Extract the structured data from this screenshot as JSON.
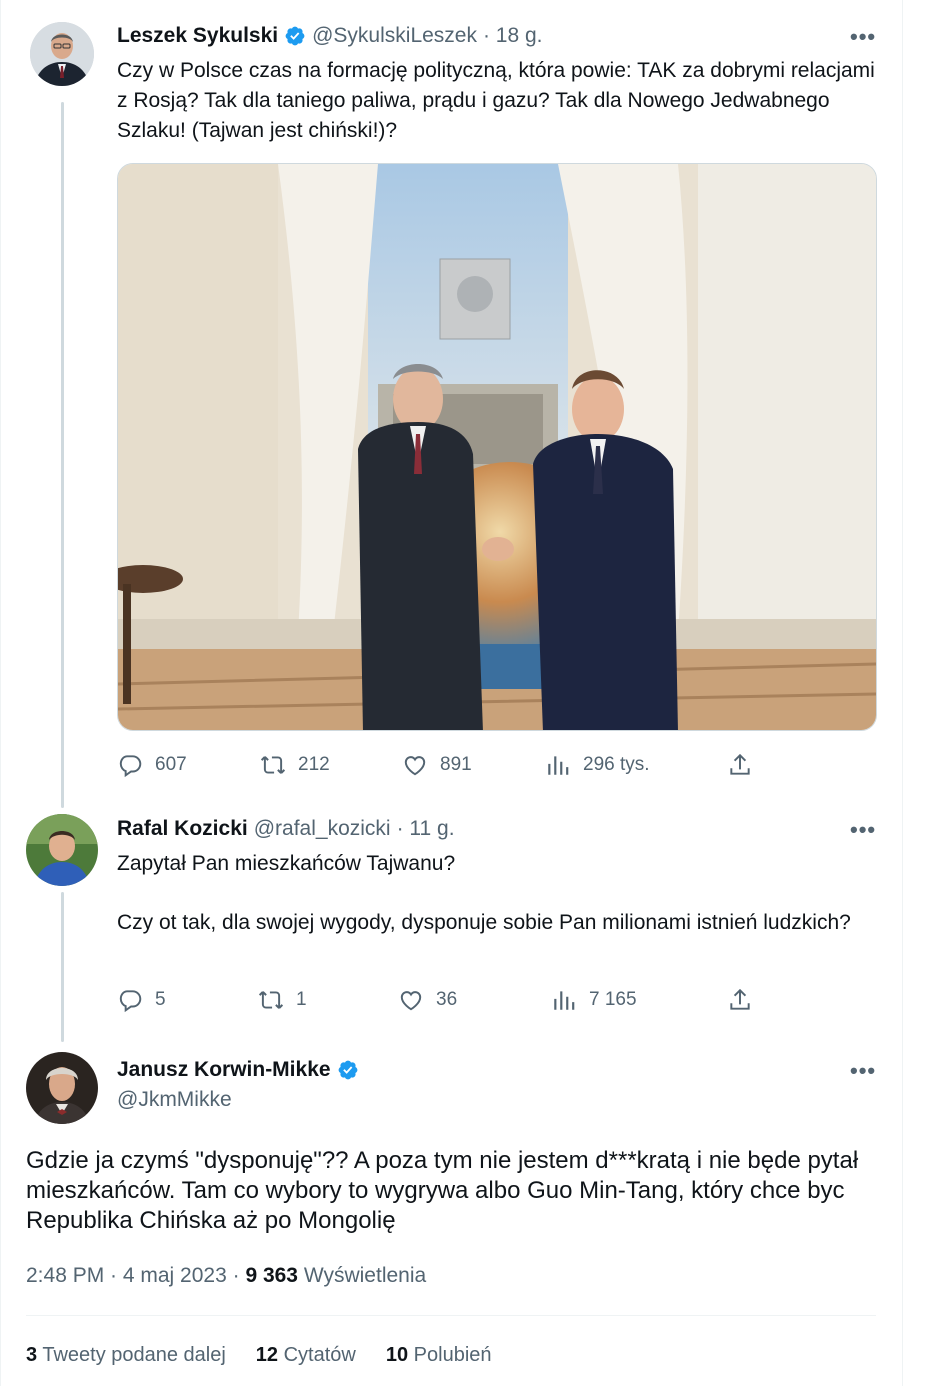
{
  "tweet1": {
    "name": "Leszek Sykulski",
    "handle": "@SykulskiLeszek",
    "time": "· 18 g.",
    "text": "Czy w Polsce czas na formację polityczną, która powie: TAK za dobrymi relacjami z Rosją? Tak dla taniego paliwa, prądu i gazu? Tak dla Nowego Jedwabnego Szlaku! (Tajwan jest chiński!)?",
    "replies": "607",
    "retweets": "212",
    "likes": "891",
    "views": "296 tys."
  },
  "tweet2": {
    "name": "Rafal Kozicki",
    "handle": "@rafal_kozicki",
    "time": "· 11 g.",
    "text_line1": "Zapytał Pan mieszkańców Tajwanu?",
    "text_line2": "Czy ot tak, dla swojej wygody, dysponuje sobie Pan milionami istnień ludzkich?",
    "replies": "5",
    "retweets": "1",
    "likes": "36",
    "views": "7 165"
  },
  "tweet3": {
    "name": "Janusz Korwin-Mikke",
    "handle": "@JkmMikke",
    "text": "Gdzie ja czymś \"dysponuję\"?? A poza tym nie jestem d***kratą i nie będe pytał mieszkańców. Tam co wybory to wygrywa albo Guo Min-Tang, który chce byc Republika Chińska aż po Mongolię",
    "timestamp": "2:48 PM · 4 maj 2023 · ",
    "views_count": "9 363",
    "views_label": "Wyświetlenia"
  },
  "stats": {
    "retweets_count": "3",
    "retweets_label": "Tweety podane dalej",
    "quotes_count": "12",
    "quotes_label": "Cytatów",
    "likes_count": "10",
    "likes_label": "Polubień"
  },
  "more_label": "•••",
  "colors": {
    "verified": "#1d9bf0",
    "muted": "#536471",
    "border": "#eff3f4"
  }
}
